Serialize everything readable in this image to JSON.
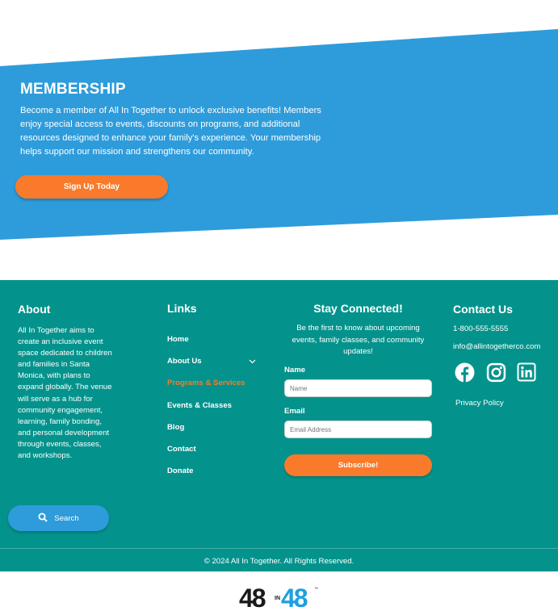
{
  "membership": {
    "title": "MEMBERSHIP",
    "description": "Become a member of All In Together to unlock exclusive benefits! Members enjoy special access to events, discounts on programs, and additional resources designed to enhance your family's experience. Your membership helps support our mission and strengthens our community.",
    "signup_label": "Sign Up Today"
  },
  "footer": {
    "about": {
      "title": "About",
      "text": "All In Together aims to create an inclusive event space dedicated to children and families in Santa Monica, with plans to expand globally. The venue will serve as a hub for community engagement, learning, family bonding, and personal development through events, classes, and workshops."
    },
    "links": {
      "title": "Links",
      "items": [
        {
          "label": "Home"
        },
        {
          "label": "About Us"
        },
        {
          "label": "Programs & Services"
        },
        {
          "label": "Events & Classes"
        },
        {
          "label": "Blog"
        },
        {
          "label": "Contact"
        },
        {
          "label": "Donate"
        }
      ]
    },
    "stay": {
      "title": "Stay Connected!",
      "description": "Be the first to know about upcoming events, family classes, and community updates!",
      "name_label": "Name",
      "name_placeholder": "Name",
      "email_label": "Email",
      "email_placeholder": "Email Address",
      "subscribe_label": "Subscribe!"
    },
    "contact": {
      "title": "Contact Us",
      "phone": "1-800-555-5555",
      "email": "info@allintogetherco.com",
      "privacy_label": "Privacy Policy",
      "social": [
        "facebook-icon",
        "instagram-icon",
        "linkedin-icon"
      ]
    },
    "search_label": "Search",
    "copyright": "© 2024 All In Together. All Rights Reserved."
  },
  "bottom_logo": {
    "left_text": "48",
    "middle_text": "IN",
    "right_text": "48",
    "tm": "™"
  },
  "colors": {
    "membership_blue": "#2e9cdb",
    "footer_teal": "#04938c",
    "accent_orange": "#f97a2a",
    "logo_blue": "#1ea0e0",
    "logo_dark": "#1a1a1a"
  }
}
